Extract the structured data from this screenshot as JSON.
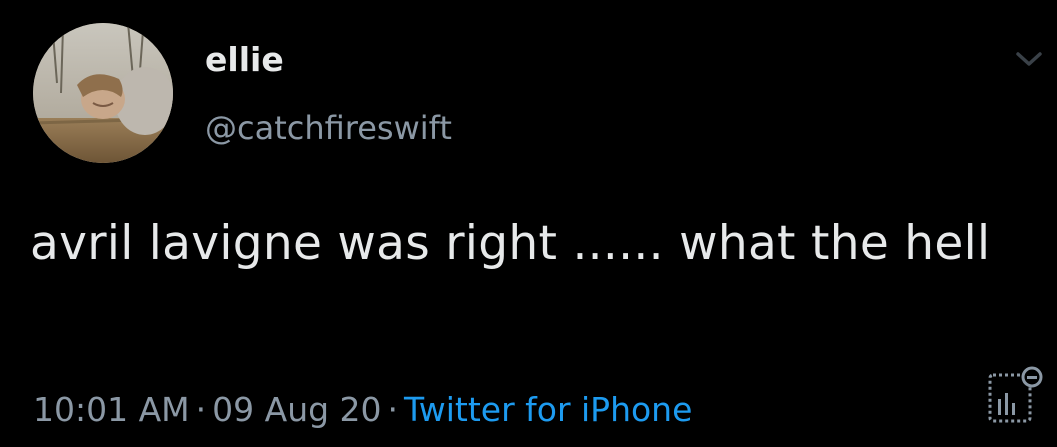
{
  "author": {
    "display_name": "ellie",
    "handle": "@catchfireswift",
    "avatar_icon": "profile-photo"
  },
  "tweet": {
    "text": "avril lavigne was right ...... what the hell"
  },
  "meta": {
    "time": "10:01 AM",
    "separator": "·",
    "date": "09 Aug 20",
    "source": "Twitter for iPhone"
  },
  "icons": {
    "more": "chevron-down-icon",
    "analytics": "analytics-icon"
  },
  "colors": {
    "background": "#000000",
    "primary_text": "#e7e9ea",
    "secondary_text": "#8b98a5",
    "link": "#1d9bf0"
  }
}
